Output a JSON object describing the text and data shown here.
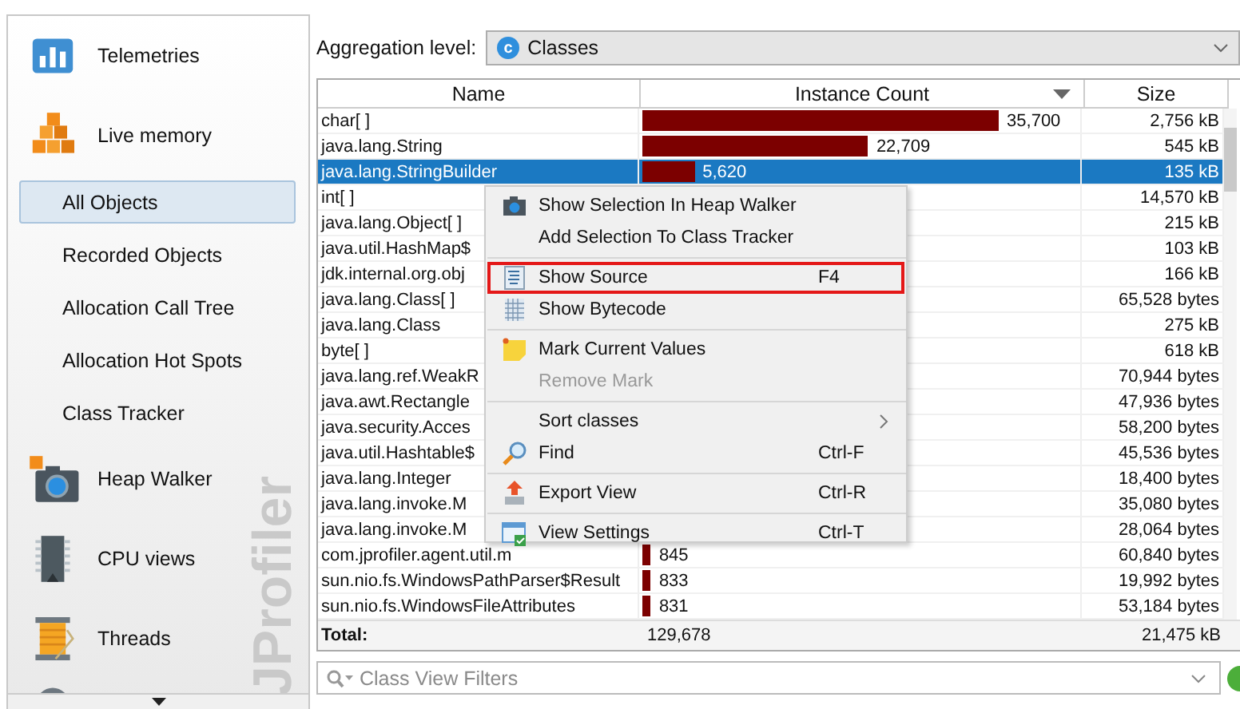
{
  "sidebar": {
    "brand": "JProfiler",
    "items": [
      {
        "label": "Telemetries"
      },
      {
        "label": "Live memory",
        "children": [
          {
            "label": "All Objects",
            "selected": true
          },
          {
            "label": "Recorded Objects",
            "selected": false
          },
          {
            "label": "Allocation Call Tree",
            "selected": false
          },
          {
            "label": "Allocation Hot Spots",
            "selected": false
          },
          {
            "label": "Class Tracker",
            "selected": false
          }
        ]
      },
      {
        "label": "Heap Walker"
      },
      {
        "label": "CPU views"
      },
      {
        "label": "Threads"
      }
    ]
  },
  "aggregation": {
    "label": "Aggregation level:",
    "icon_text": "c",
    "value": "Classes"
  },
  "table": {
    "columns": [
      "Name",
      "Instance Count",
      "Size"
    ],
    "rows": [
      {
        "name": "char[ ]",
        "count": "35,700",
        "level": 0.82,
        "size": "2,756 kB",
        "selected": false
      },
      {
        "name": "java.lang.String",
        "count": "22,709",
        "level": 0.52,
        "size": "545 kB",
        "selected": false
      },
      {
        "name": "java.lang.StringBuilder",
        "count": "5,620",
        "level": 0.12,
        "size": "135 kB",
        "selected": true
      },
      {
        "name": "int[ ]",
        "size": "14,570 kB",
        "selected": false
      },
      {
        "name": "java.lang.Object[ ]",
        "size": "215 kB",
        "selected": false
      },
      {
        "name": "java.util.HashMap$",
        "size": "103 kB",
        "selected": false
      },
      {
        "name": "jdk.internal.org.obj",
        "size": "166 kB",
        "selected": false
      },
      {
        "name": "java.lang.Class[ ]",
        "size": "65,528 bytes",
        "selected": false
      },
      {
        "name": "java.lang.Class",
        "size": "275 kB",
        "selected": false
      },
      {
        "name": "byte[ ]",
        "size": "618 kB",
        "selected": false
      },
      {
        "name": "java.lang.ref.WeakR",
        "size": "70,944 bytes",
        "selected": false
      },
      {
        "name": "java.awt.Rectangle",
        "size": "47,936 bytes",
        "selected": false
      },
      {
        "name": "java.security.Acces",
        "size": "58,200 bytes",
        "selected": false
      },
      {
        "name": "java.util.Hashtable$",
        "size": "45,536 bytes",
        "selected": false
      },
      {
        "name": "java.lang.Integer",
        "size": "18,400 bytes",
        "selected": false
      },
      {
        "name": "java.lang.invoke.M",
        "size": "35,080 bytes",
        "selected": false
      },
      {
        "name": "java.lang.invoke.M",
        "size": "28,064 bytes",
        "selected": false
      },
      {
        "name": "com.jprofiler.agent.util.m",
        "count": "845",
        "level": 0.02,
        "size": "60,840 bytes",
        "selected": false
      },
      {
        "name": "sun.nio.fs.WindowsPathParser$Result",
        "count": "833",
        "level": 0.02,
        "size": "19,992 bytes",
        "selected": false
      },
      {
        "name": "sun.nio.fs.WindowsFileAttributes",
        "count": "831",
        "level": 0.02,
        "size": "53,184 bytes",
        "selected": false
      }
    ],
    "total": {
      "label": "Total:",
      "count": "129,678",
      "size": "21,475 kB"
    }
  },
  "context_menu": {
    "groups": [
      [
        {
          "label": "Show Selection In Heap Walker",
          "disabled": false,
          "highlighted": false,
          "submenu": false
        },
        {
          "label": "Add Selection To Class Tracker",
          "disabled": false,
          "highlighted": false,
          "submenu": false
        }
      ],
      [
        {
          "label": "Show Source",
          "shortcut": "F4",
          "disabled": false,
          "highlighted": true,
          "submenu": false
        },
        {
          "label": "Show Bytecode",
          "disabled": false,
          "highlighted": false,
          "submenu": false
        }
      ],
      [
        {
          "label": "Mark Current Values",
          "disabled": false,
          "highlighted": false,
          "submenu": false
        },
        {
          "label": "Remove Mark",
          "disabled": true,
          "highlighted": false,
          "submenu": false
        }
      ],
      [
        {
          "label": "Sort classes",
          "disabled": false,
          "highlighted": false,
          "submenu": true
        },
        {
          "label": "Find",
          "shortcut": "Ctrl-F",
          "disabled": false,
          "highlighted": false,
          "submenu": false
        }
      ],
      [
        {
          "label": "Export View",
          "shortcut": "Ctrl-R",
          "disabled": false,
          "highlighted": false,
          "submenu": false
        }
      ],
      [
        {
          "label": "View Settings",
          "shortcut": "Ctrl-T",
          "disabled": false,
          "highlighted": false,
          "submenu": false
        }
      ]
    ]
  },
  "filter": {
    "placeholder": "Class View Filters"
  }
}
